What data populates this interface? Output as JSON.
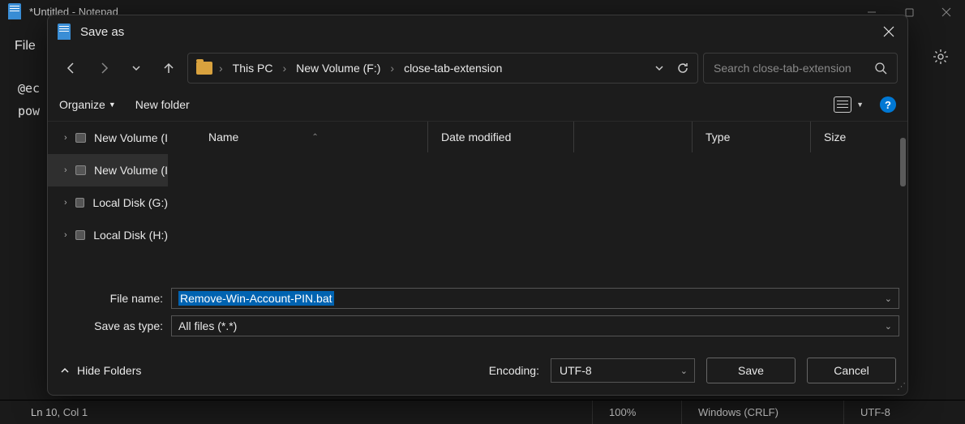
{
  "notepad": {
    "title": "*Untitled - Notepad",
    "menu_file": "File",
    "body_line1": "@ec",
    "body_line2": "pow",
    "status": {
      "pos": "Ln 10, Col 1",
      "zoom": "100%",
      "eol": "Windows (CRLF)",
      "enc": "UTF-8"
    }
  },
  "dialog": {
    "title": "Save as",
    "breadcrumb": [
      "This PC",
      "New Volume (F:)",
      "close-tab-extension"
    ],
    "search_placeholder": "Search close-tab-extension",
    "toolbar": {
      "organize": "Organize",
      "new_folder": "New folder"
    },
    "tree": [
      {
        "label": "New Volume (I"
      },
      {
        "label": "New Volume (I"
      },
      {
        "label": "Local Disk (G:)"
      },
      {
        "label": "Local Disk (H:)"
      }
    ],
    "columns": {
      "name": "Name",
      "date": "Date modified",
      "type": "Type",
      "size": "Size"
    },
    "fields": {
      "file_name_label": "File name:",
      "file_name_value": "Remove-Win-Account-PIN.bat",
      "save_type_label": "Save as type:",
      "save_type_value": "All files  (*.*)"
    },
    "footer": {
      "hide_folders": "Hide Folders",
      "encoding_label": "Encoding:",
      "encoding_value": "UTF-8",
      "save": "Save",
      "cancel": "Cancel"
    }
  }
}
